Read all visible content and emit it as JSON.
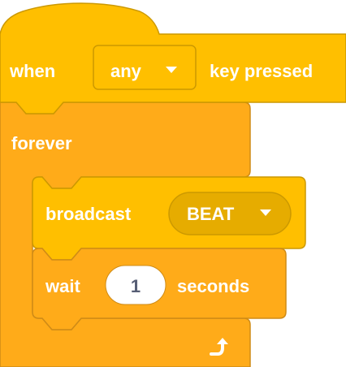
{
  "colors": {
    "events": "#ffbf00",
    "events_border": "#cc9900",
    "events_dropdown": "#e6ac00",
    "control": "#ffab19",
    "control_border": "#cf8b17",
    "text": "#ffffff",
    "number_text": "#575e75"
  },
  "hat_block": {
    "when_label": "when",
    "key_dropdown_value": "any",
    "key_pressed_label": "key pressed"
  },
  "forever_block": {
    "label": "forever",
    "loop_icon": "loop-arrow-icon"
  },
  "broadcast_block": {
    "label": "broadcast",
    "message_value": "BEAT"
  },
  "wait_block": {
    "label": "wait",
    "duration_value": "1",
    "seconds_label": "seconds"
  },
  "dropdown_icon": "triangle-down-icon"
}
